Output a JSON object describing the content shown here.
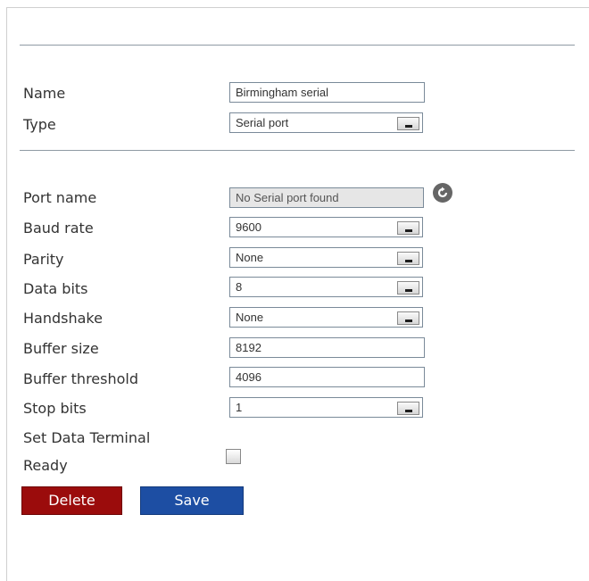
{
  "form": {
    "name_label": "Name",
    "name_value": "Birmingham serial",
    "type_label": "Type",
    "type_value": "Serial port",
    "port_name_label": "Port name",
    "port_name_value": "No Serial port found",
    "baud_rate_label": "Baud rate",
    "baud_rate_value": "9600",
    "parity_label": "Parity",
    "parity_value": "None",
    "data_bits_label": "Data bits",
    "data_bits_value": "8",
    "handshake_label": "Handshake",
    "handshake_value": "None",
    "buffer_size_label": "Buffer size",
    "buffer_size_value": "8192",
    "buffer_threshold_label": "Buffer threshold",
    "buffer_threshold_value": "4096",
    "stop_bits_label": "Stop bits",
    "stop_bits_value": "1",
    "set_dtr_label_line1": "Set Data Terminal",
    "set_dtr_label_line2": "Ready",
    "set_dtr_checked": false
  },
  "icons": {
    "refresh": "refresh-icon",
    "dropdown": "chevron-down-icon"
  },
  "buttons": {
    "delete_label": "Delete",
    "save_label": "Save"
  },
  "colors": {
    "delete_button": "#9b0c0c",
    "save_button": "#1d4ea3"
  }
}
